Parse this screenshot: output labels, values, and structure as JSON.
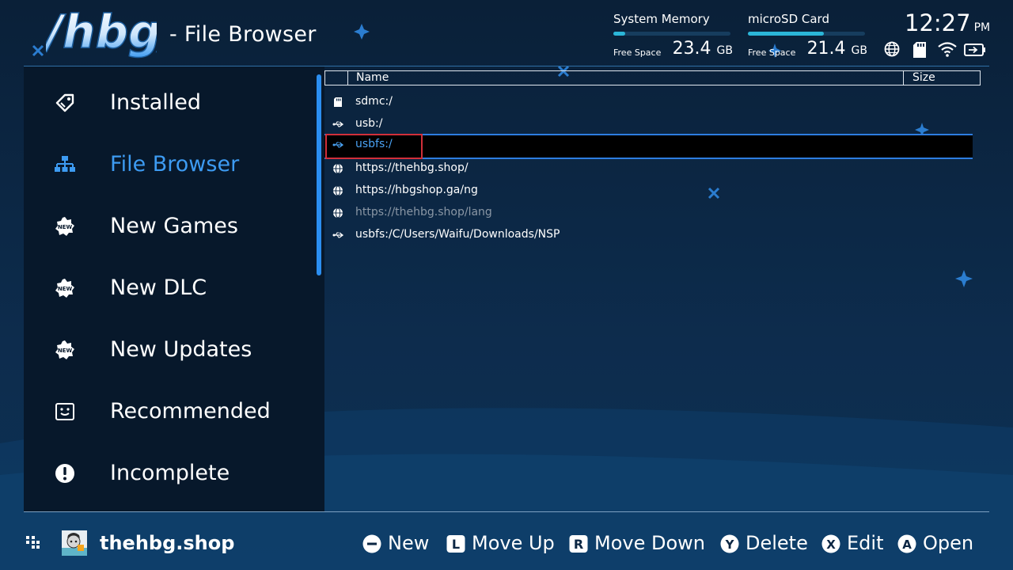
{
  "header": {
    "logo_text": "/hbg/",
    "title": "- File Browser",
    "storage": [
      {
        "title": "System Memory",
        "free_label": "Free Space",
        "value": "23.4",
        "unit": "GB",
        "fill": 0.1
      },
      {
        "title": "microSD Card",
        "free_label": "Free Space",
        "value": "21.4",
        "unit": "GB",
        "fill": 0.65
      }
    ],
    "clock": {
      "time": "12:27",
      "ampm": "PM"
    },
    "status_icons": [
      "globe-icon",
      "sd-card-icon",
      "wifi-icon",
      "battery-icon"
    ]
  },
  "sidebar": {
    "items": [
      {
        "label": "Installed",
        "icon": "tag-icon",
        "active": false
      },
      {
        "label": "File Browser",
        "icon": "network-icon",
        "active": true
      },
      {
        "label": "New Games",
        "icon": "new-badge-icon",
        "active": false
      },
      {
        "label": "New DLC",
        "icon": "new-badge-icon",
        "active": false
      },
      {
        "label": "New Updates",
        "icon": "new-badge-icon",
        "active": false
      },
      {
        "label": "Recommended",
        "icon": "smiley-icon",
        "active": false
      },
      {
        "label": "Incomplete",
        "icon": "alert-icon",
        "active": false
      }
    ]
  },
  "browser": {
    "columns": {
      "name": "Name",
      "size": "Size"
    },
    "rows": [
      {
        "label": "sdmc:/",
        "icon": "sd-card-icon",
        "selected": false,
        "dim": false
      },
      {
        "label": "usb:/",
        "icon": "usb-icon",
        "selected": false,
        "dim": false
      },
      {
        "label": "usbfs:/",
        "icon": "usb-icon",
        "selected": true,
        "dim": false
      },
      {
        "label": "https://thehbg.shop/",
        "icon": "globe-icon",
        "selected": false,
        "dim": false
      },
      {
        "label": "https://hbgshop.ga/ng",
        "icon": "globe-icon",
        "selected": false,
        "dim": false
      },
      {
        "label": "https://thehbg.shop/lang",
        "icon": "globe-icon",
        "selected": false,
        "dim": true
      },
      {
        "label": "usbfs:/C/Users/Waifu/Downloads/NSP",
        "icon": "usb-icon",
        "selected": false,
        "dim": false
      }
    ]
  },
  "footer": {
    "user": "thehbg.shop",
    "hints": [
      {
        "button": "minus",
        "label": "New"
      },
      {
        "button": "L",
        "label": "Move Up"
      },
      {
        "button": "R",
        "label": "Move Down"
      },
      {
        "button": "Y",
        "label": "Delete"
      },
      {
        "button": "X",
        "label": "Edit"
      },
      {
        "button": "A",
        "label": "Open"
      }
    ]
  },
  "colors": {
    "background": "#0b2643",
    "sidebar": "#07182b",
    "accent": "#3d9bf2",
    "selection_outline": "#d12f3a",
    "storage_bar": "#2bb6d8"
  }
}
